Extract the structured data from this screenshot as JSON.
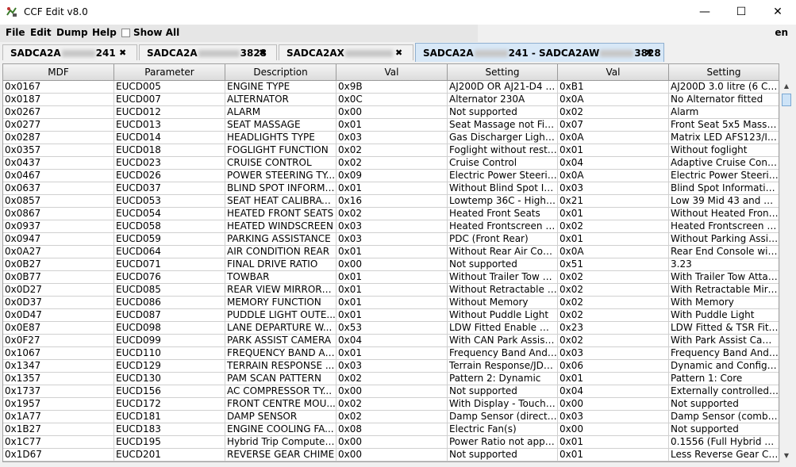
{
  "window": {
    "title": "CCF Edit v8.0",
    "minimize": "—",
    "maximize": "☐",
    "close": "✕"
  },
  "menu": {
    "file": "File",
    "edit": "Edit",
    "dump": "Dump",
    "help": "Help",
    "show_all": "Show All",
    "language": "en"
  },
  "tabs": [
    {
      "prefix": "SADCA2A",
      "suffix": "241"
    },
    {
      "prefix": "SADCA2A",
      "suffix": "3828"
    },
    {
      "prefix": "SADCA2AX",
      "suffix": ""
    },
    {
      "prefix": "SADCA2A",
      "suffix": "241 - SADCA2AW",
      "suffix2": "3828"
    }
  ],
  "columns": [
    "MDF",
    "Parameter",
    "Description",
    "Val",
    "Setting",
    "Val",
    "Setting"
  ],
  "rows": [
    [
      "0x0167",
      "EUCD005",
      "ENGINE TYPE",
      "0x9B",
      "AJ200D OR AJ21-D4 2...",
      "0xB1",
      "AJ200D 3.0 litre (6 Cyl.)"
    ],
    [
      "0x0187",
      "EUCD007",
      "ALTERNATOR",
      "0x0C",
      "Alternator 230A",
      "0x0A",
      "No Alternator fitted"
    ],
    [
      "0x0267",
      "EUCD012",
      "ALARM",
      "0x00",
      "Not supported",
      "0x02",
      "Alarm"
    ],
    [
      "0x0277",
      "EUCD013",
      "SEAT MASSAGE",
      "0x01",
      "Seat Massage not Fitted",
      "0x07",
      "Front Seat 5x5 Massag..."
    ],
    [
      "0x0287",
      "EUCD014",
      "HEADLIGHTS TYPE",
      "0x03",
      "Gas Discharger Lights ...",
      "0x0A",
      "Matrix LED AFS123/IHB"
    ],
    [
      "0x0357",
      "EUCD018",
      "FOGLIGHT FUNCTION",
      "0x02",
      "Foglight without restrict...",
      "0x01",
      "Without foglight"
    ],
    [
      "0x0437",
      "EUCD023",
      "CRUISE CONTROL",
      "0x02",
      "Cruise Control",
      "0x04",
      "Adaptive Cruise Contro..."
    ],
    [
      "0x0467",
      "EUCD026",
      "POWER STEERING TY...",
      "0x09",
      "Electric Power Steering...",
      "0x0A",
      "Electric Power Steering..."
    ],
    [
      "0x0637",
      "EUCD037",
      "BLIND SPOT INFORMA...",
      "0x01",
      "Without Blind Spot Infor...",
      "0x03",
      "Blind Spot Information ..."
    ],
    [
      "0x0857",
      "EUCD053",
      "SEAT HEAT CALIBRATI...",
      "0x16",
      "Lowtemp 36C - Highte...",
      "0x21",
      "Low 39 Mid 43 and Hig..."
    ],
    [
      "0x0867",
      "EUCD054",
      "HEATED FRONT SEATS",
      "0x02",
      "Heated Front Seats",
      "0x01",
      "Without Heated Front S..."
    ],
    [
      "0x0937",
      "EUCD058",
      "HEATED WINDSCREEN",
      "0x03",
      "Heated Frontscreen & ...",
      "0x02",
      "Heated Frontscreen only"
    ],
    [
      "0x0947",
      "EUCD059",
      "PARKING ASSISTANCE",
      "0x03",
      "PDC (Front Rear)",
      "0x01",
      "Without Parking Assist..."
    ],
    [
      "0x0A27",
      "EUCD064",
      "AIR CONDITION REAR",
      "0x01",
      "Without Rear Air Condit...",
      "0x0A",
      "Rear End Console with..."
    ],
    [
      "0x0B27",
      "EUCD071",
      "FINAL DRIVE RATIO",
      "0x00",
      "Not supported",
      "0x51",
      "3.23"
    ],
    [
      "0x0B77",
      "EUCD076",
      "TOWBAR",
      "0x01",
      "Without Trailer Tow Att...",
      "0x02",
      "With Trailer Tow Attach..."
    ],
    [
      "0x0D27",
      "EUCD085",
      "REAR VIEW MIRRORS ...",
      "0x01",
      "Without Retractable Mir...",
      "0x02",
      "With Retractable Mirrors"
    ],
    [
      "0x0D37",
      "EUCD086",
      "MEMORY FUNCTION",
      "0x01",
      "Without Memory",
      "0x02",
      "With Memory"
    ],
    [
      "0x0D47",
      "EUCD087",
      "PUDDLE LIGHT OUTE...",
      "0x01",
      "Without Puddle Light",
      "0x02",
      "With Puddle Light"
    ],
    [
      "0x0E87",
      "EUCD098",
      "LANE DEPARTURE W...",
      "0x53",
      "LDW Fitted Enable Me...",
      "0x23",
      "LDW Fitted & TSR Fitte..."
    ],
    [
      "0x0F27",
      "EUCD099",
      "PARK ASSIST CAMERA",
      "0x04",
      "With CAN Park Assist ...",
      "0x02",
      "With Park Assist Came..."
    ],
    [
      "0x1067",
      "EUCD110",
      "FREQUENCY BAND An...",
      "0x01",
      "Frequency Band And St...",
      "0x03",
      "Frequency Band And St..."
    ],
    [
      "0x1347",
      "EUCD129",
      "TERRAIN RESPONSE ...",
      "0x03",
      "Terrain Response/JDO...",
      "0x06",
      "Dynamic and Configur..."
    ],
    [
      "0x1357",
      "EUCD130",
      "PAM SCAN PATTERN",
      "0x02",
      "Pattern 2: Dynamic",
      "0x01",
      "Pattern 1: Core"
    ],
    [
      "0x1737",
      "EUCD156",
      "AC COMPRESSOR TY...",
      "0x00",
      "Not supported",
      "0x04",
      "Externally controlled va..."
    ],
    [
      "0x1957",
      "EUCD172",
      "FRONT CENTRE MOU...",
      "0x02",
      "With Display - Touchsc...",
      "0x00",
      "Not supported"
    ],
    [
      "0x1A77",
      "EUCD181",
      "DAMP SENSOR",
      "0x02",
      "Damp Sensor (direct to...",
      "0x03",
      "Damp Sensor (combin..."
    ],
    [
      "0x1B27",
      "EUCD183",
      "ENGINE COOLING FA...",
      "0x08",
      "Electric Fan(s)",
      "0x00",
      "Not supported"
    ],
    [
      "0x1C77",
      "EUCD195",
      "Hybrid Trip Computer P...",
      "0x00",
      "Power Ratio not applic...",
      "0x01",
      "0.1556 (Full Hybrid Die..."
    ],
    [
      "0x1D67",
      "EUCD201",
      "REVERSE GEAR CHIME",
      "0x00",
      "Not supported",
      "0x01",
      "Less Reverse Gear Ch..."
    ]
  ]
}
